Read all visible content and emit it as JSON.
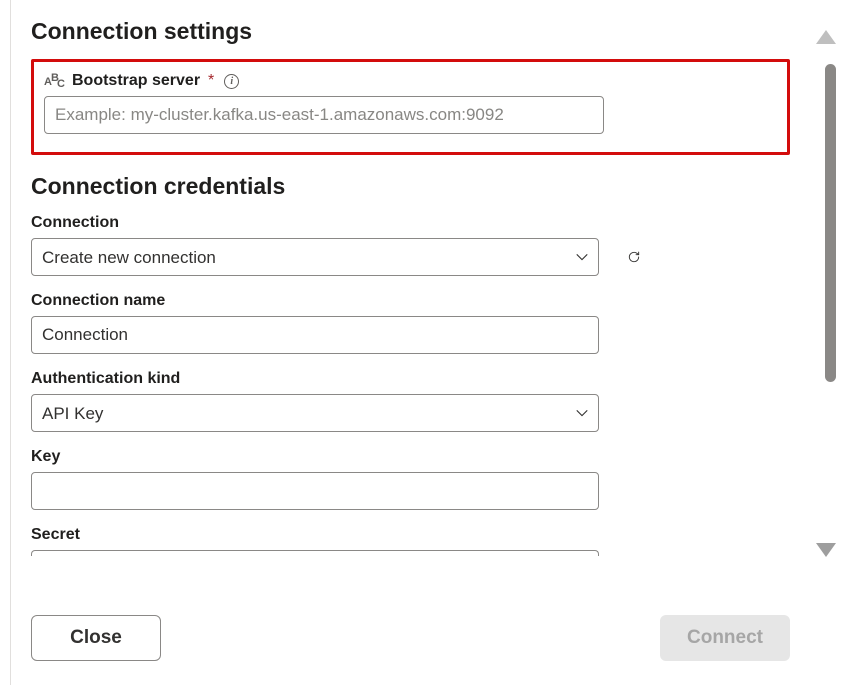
{
  "sections": {
    "connection_settings_title": "Connection settings",
    "connection_credentials_title": "Connection credentials"
  },
  "bootstrap": {
    "label": "Bootstrap server",
    "required_marker": "*",
    "placeholder": "Example: my-cluster.kafka.us-east-1.amazonaws.com:9092",
    "value": ""
  },
  "connection": {
    "label": "Connection",
    "selected": "Create new connection",
    "options": [
      "Create new connection"
    ]
  },
  "connection_name": {
    "label": "Connection name",
    "value": "Connection"
  },
  "auth_kind": {
    "label": "Authentication kind",
    "selected": "API Key",
    "options": [
      "API Key"
    ]
  },
  "key_field": {
    "label": "Key",
    "value": ""
  },
  "secret_field": {
    "label": "Secret",
    "value": ""
  },
  "footer": {
    "close_label": "Close",
    "connect_label": "Connect"
  }
}
